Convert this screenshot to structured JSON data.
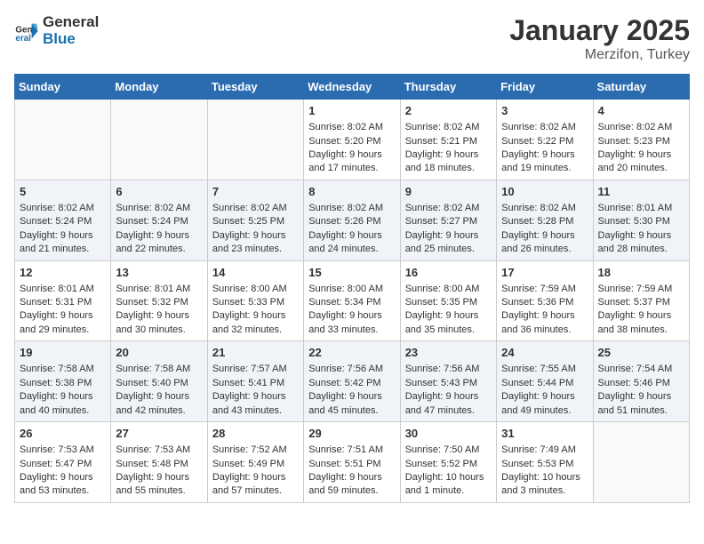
{
  "header": {
    "logo_general": "General",
    "logo_blue": "Blue",
    "month": "January 2025",
    "location": "Merzifon, Turkey"
  },
  "weekdays": [
    "Sunday",
    "Monday",
    "Tuesday",
    "Wednesday",
    "Thursday",
    "Friday",
    "Saturday"
  ],
  "weeks": [
    [
      {
        "day": "",
        "content": ""
      },
      {
        "day": "",
        "content": ""
      },
      {
        "day": "",
        "content": ""
      },
      {
        "day": "1",
        "content": "Sunrise: 8:02 AM\nSunset: 5:20 PM\nDaylight: 9 hours\nand 17 minutes."
      },
      {
        "day": "2",
        "content": "Sunrise: 8:02 AM\nSunset: 5:21 PM\nDaylight: 9 hours\nand 18 minutes."
      },
      {
        "day": "3",
        "content": "Sunrise: 8:02 AM\nSunset: 5:22 PM\nDaylight: 9 hours\nand 19 minutes."
      },
      {
        "day": "4",
        "content": "Sunrise: 8:02 AM\nSunset: 5:23 PM\nDaylight: 9 hours\nand 20 minutes."
      }
    ],
    [
      {
        "day": "5",
        "content": "Sunrise: 8:02 AM\nSunset: 5:24 PM\nDaylight: 9 hours\nand 21 minutes."
      },
      {
        "day": "6",
        "content": "Sunrise: 8:02 AM\nSunset: 5:24 PM\nDaylight: 9 hours\nand 22 minutes."
      },
      {
        "day": "7",
        "content": "Sunrise: 8:02 AM\nSunset: 5:25 PM\nDaylight: 9 hours\nand 23 minutes."
      },
      {
        "day": "8",
        "content": "Sunrise: 8:02 AM\nSunset: 5:26 PM\nDaylight: 9 hours\nand 24 minutes."
      },
      {
        "day": "9",
        "content": "Sunrise: 8:02 AM\nSunset: 5:27 PM\nDaylight: 9 hours\nand 25 minutes."
      },
      {
        "day": "10",
        "content": "Sunrise: 8:02 AM\nSunset: 5:28 PM\nDaylight: 9 hours\nand 26 minutes."
      },
      {
        "day": "11",
        "content": "Sunrise: 8:01 AM\nSunset: 5:30 PM\nDaylight: 9 hours\nand 28 minutes."
      }
    ],
    [
      {
        "day": "12",
        "content": "Sunrise: 8:01 AM\nSunset: 5:31 PM\nDaylight: 9 hours\nand 29 minutes."
      },
      {
        "day": "13",
        "content": "Sunrise: 8:01 AM\nSunset: 5:32 PM\nDaylight: 9 hours\nand 30 minutes."
      },
      {
        "day": "14",
        "content": "Sunrise: 8:00 AM\nSunset: 5:33 PM\nDaylight: 9 hours\nand 32 minutes."
      },
      {
        "day": "15",
        "content": "Sunrise: 8:00 AM\nSunset: 5:34 PM\nDaylight: 9 hours\nand 33 minutes."
      },
      {
        "day": "16",
        "content": "Sunrise: 8:00 AM\nSunset: 5:35 PM\nDaylight: 9 hours\nand 35 minutes."
      },
      {
        "day": "17",
        "content": "Sunrise: 7:59 AM\nSunset: 5:36 PM\nDaylight: 9 hours\nand 36 minutes."
      },
      {
        "day": "18",
        "content": "Sunrise: 7:59 AM\nSunset: 5:37 PM\nDaylight: 9 hours\nand 38 minutes."
      }
    ],
    [
      {
        "day": "19",
        "content": "Sunrise: 7:58 AM\nSunset: 5:38 PM\nDaylight: 9 hours\nand 40 minutes."
      },
      {
        "day": "20",
        "content": "Sunrise: 7:58 AM\nSunset: 5:40 PM\nDaylight: 9 hours\nand 42 minutes."
      },
      {
        "day": "21",
        "content": "Sunrise: 7:57 AM\nSunset: 5:41 PM\nDaylight: 9 hours\nand 43 minutes."
      },
      {
        "day": "22",
        "content": "Sunrise: 7:56 AM\nSunset: 5:42 PM\nDaylight: 9 hours\nand 45 minutes."
      },
      {
        "day": "23",
        "content": "Sunrise: 7:56 AM\nSunset: 5:43 PM\nDaylight: 9 hours\nand 47 minutes."
      },
      {
        "day": "24",
        "content": "Sunrise: 7:55 AM\nSunset: 5:44 PM\nDaylight: 9 hours\nand 49 minutes."
      },
      {
        "day": "25",
        "content": "Sunrise: 7:54 AM\nSunset: 5:46 PM\nDaylight: 9 hours\nand 51 minutes."
      }
    ],
    [
      {
        "day": "26",
        "content": "Sunrise: 7:53 AM\nSunset: 5:47 PM\nDaylight: 9 hours\nand 53 minutes."
      },
      {
        "day": "27",
        "content": "Sunrise: 7:53 AM\nSunset: 5:48 PM\nDaylight: 9 hours\nand 55 minutes."
      },
      {
        "day": "28",
        "content": "Sunrise: 7:52 AM\nSunset: 5:49 PM\nDaylight: 9 hours\nand 57 minutes."
      },
      {
        "day": "29",
        "content": "Sunrise: 7:51 AM\nSunset: 5:51 PM\nDaylight: 9 hours\nand 59 minutes."
      },
      {
        "day": "30",
        "content": "Sunrise: 7:50 AM\nSunset: 5:52 PM\nDaylight: 10 hours\nand 1 minute."
      },
      {
        "day": "31",
        "content": "Sunrise: 7:49 AM\nSunset: 5:53 PM\nDaylight: 10 hours\nand 3 minutes."
      },
      {
        "day": "",
        "content": ""
      }
    ]
  ]
}
